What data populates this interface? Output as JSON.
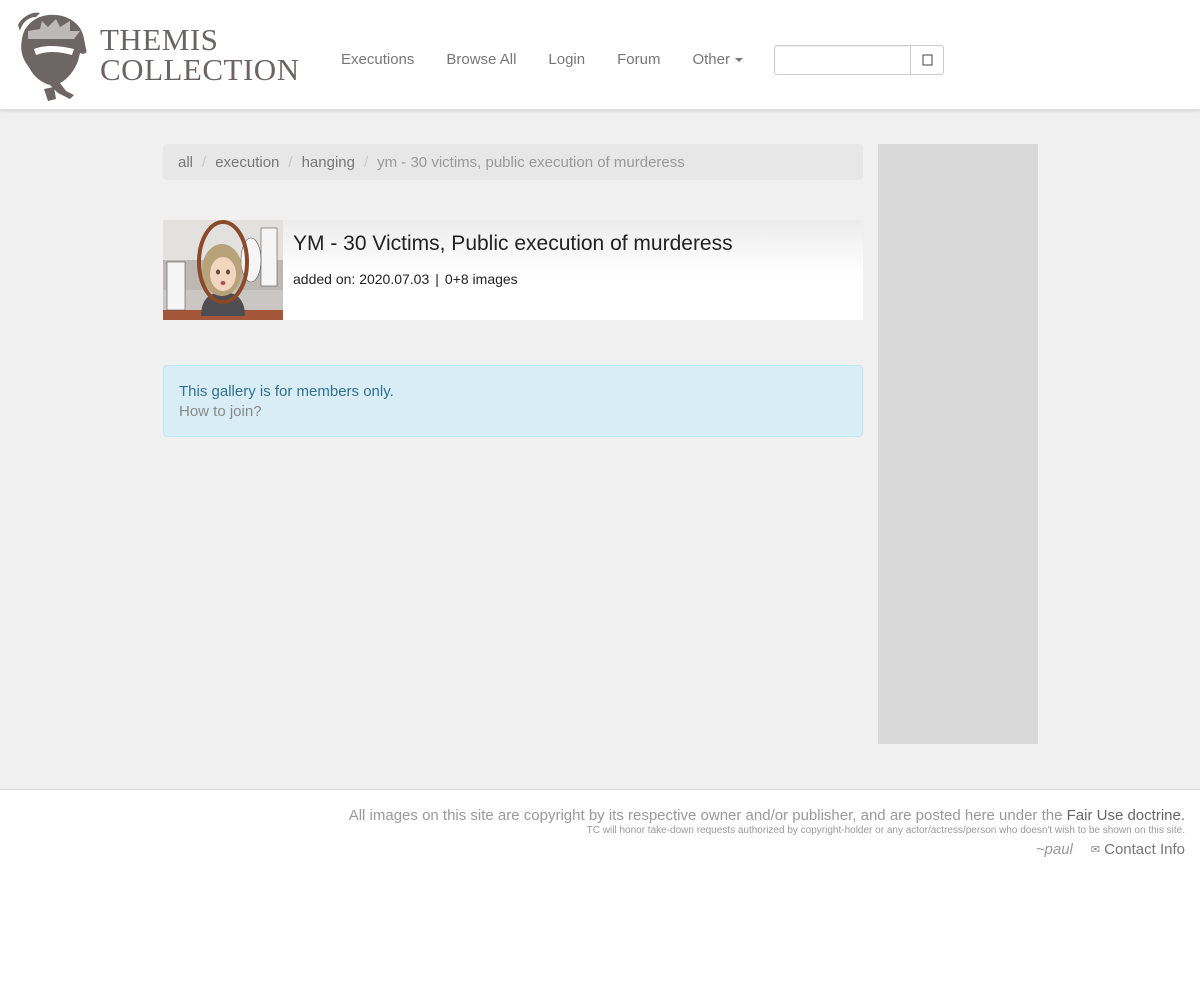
{
  "site": {
    "logo_line1": "THEMIS",
    "logo_line2": "COLLECTION"
  },
  "nav": {
    "items": [
      {
        "label": "Executions"
      },
      {
        "label": "Browse All"
      },
      {
        "label": "Login"
      },
      {
        "label": "Forum"
      },
      {
        "label": "Other"
      }
    ]
  },
  "search": {
    "value": "",
    "placeholder": "",
    "button_icon": "search-icon"
  },
  "breadcrumb": {
    "items": [
      {
        "label": "all"
      },
      {
        "label": "execution"
      },
      {
        "label": "hanging"
      },
      {
        "label": "ym - 30 victims, public execution of murderess"
      }
    ],
    "separator": "/"
  },
  "gallery": {
    "title": "YM - 30 Victims, Public execution of murderess",
    "added_label": "added on:",
    "added_date": "2020.07.03",
    "image_count": "0+8 images"
  },
  "alert": {
    "message": "This gallery is for members only.",
    "join_link": "How to join?"
  },
  "footer": {
    "copyright_prefix": "All images on this site are copyright by its respective owner and/or publisher, and are posted here under the",
    "fair_use_link": "Fair Use doctrine.",
    "takedown_note": "TC will honor take-down requests authorized by copyright-holder or any actor/actress/person who doesn't wish to be shown on this site.",
    "signature": "~paul",
    "contact_label": "Contact Info",
    "contact_icon": "envelope-icon"
  },
  "colors": {
    "alert_bg": "#d9edf7",
    "alert_text": "#31708f",
    "page_bg": "#f0f0f0",
    "logo": "#6b6464"
  }
}
